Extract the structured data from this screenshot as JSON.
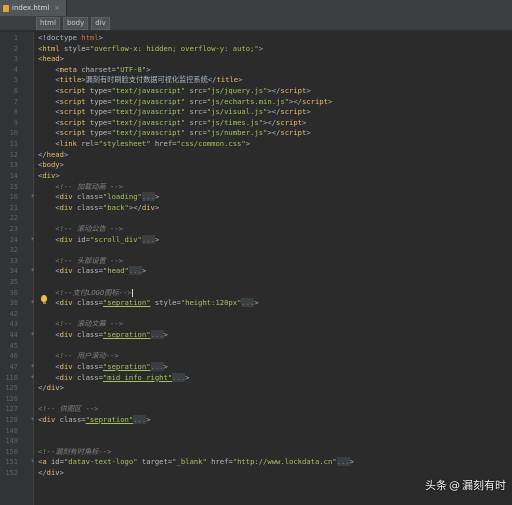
{
  "tab": {
    "filename": "index.html",
    "close_glyph": "×"
  },
  "breadcrumbs": [
    "html",
    "body",
    "div"
  ],
  "watermark": {
    "brand": "头条",
    "at": "@",
    "author": "漏刻有时"
  },
  "lines": [
    {
      "n": "1",
      "fold": "",
      "segs": [
        [
          "t",
          "<!doctype "
        ],
        [
          "k",
          "html"
        ],
        [
          "t",
          ">"
        ]
      ]
    },
    {
      "n": "2",
      "fold": "",
      "segs": [
        [
          "t",
          "<"
        ],
        [
          "g",
          "html"
        ],
        [
          "a",
          " style="
        ],
        [
          "v",
          "\"overflow-x: hidden; overflow-y: auto;\""
        ],
        [
          "t",
          ">"
        ]
      ]
    },
    {
      "n": "3",
      "fold": "",
      "segs": [
        [
          "t",
          "<"
        ],
        [
          "g",
          "head"
        ],
        [
          "t",
          ">"
        ]
      ]
    },
    {
      "n": "4",
      "fold": "",
      "segs": [
        [
          "t",
          "    <"
        ],
        [
          "g",
          "meta"
        ],
        [
          "a",
          " charset="
        ],
        [
          "v",
          "\"UTF-8\""
        ],
        [
          "t",
          ">"
        ]
      ]
    },
    {
      "n": "5",
      "fold": "",
      "segs": [
        [
          "t",
          "    <"
        ],
        [
          "g",
          "title"
        ],
        [
          "t",
          ">漏刻有时刷脸支付数据可视化监控系统</"
        ],
        [
          "g",
          "title"
        ],
        [
          "t",
          ">"
        ]
      ]
    },
    {
      "n": "6",
      "fold": "",
      "segs": [
        [
          "t",
          "    <"
        ],
        [
          "g",
          "script"
        ],
        [
          "a",
          " type="
        ],
        [
          "v",
          "\"text/javascript\""
        ],
        [
          "a",
          " src="
        ],
        [
          "v",
          "\"js/jquery.js\""
        ],
        [
          "t",
          "></"
        ],
        [
          "g",
          "script"
        ],
        [
          "t",
          ">"
        ]
      ]
    },
    {
      "n": "7",
      "fold": "",
      "segs": [
        [
          "t",
          "    <"
        ],
        [
          "g",
          "script"
        ],
        [
          "a",
          " type="
        ],
        [
          "v",
          "\"text/javascript\""
        ],
        [
          "a",
          " src="
        ],
        [
          "v",
          "\"js/echarts.min.js\""
        ],
        [
          "t",
          "></"
        ],
        [
          "g",
          "script"
        ],
        [
          "t",
          ">"
        ]
      ]
    },
    {
      "n": "8",
      "fold": "",
      "segs": [
        [
          "t",
          "    <"
        ],
        [
          "g",
          "script"
        ],
        [
          "a",
          " type="
        ],
        [
          "v",
          "\"text/javascript\""
        ],
        [
          "a",
          " src="
        ],
        [
          "v",
          "\"js/visual.js\""
        ],
        [
          "t",
          "></"
        ],
        [
          "g",
          "script"
        ],
        [
          "t",
          ">"
        ]
      ]
    },
    {
      "n": "9",
      "fold": "",
      "segs": [
        [
          "t",
          "    <"
        ],
        [
          "g",
          "script"
        ],
        [
          "a",
          " type="
        ],
        [
          "v",
          "\"text/javascript\""
        ],
        [
          "a",
          " src="
        ],
        [
          "v",
          "\"js/times.js\""
        ],
        [
          "t",
          "></"
        ],
        [
          "g",
          "script"
        ],
        [
          "t",
          ">"
        ]
      ]
    },
    {
      "n": "10",
      "fold": "",
      "segs": [
        [
          "t",
          "    <"
        ],
        [
          "g",
          "script"
        ],
        [
          "a",
          " type="
        ],
        [
          "v",
          "\"text/javascript\""
        ],
        [
          "a",
          " src="
        ],
        [
          "v",
          "\"js/number.js\""
        ],
        [
          "t",
          "></"
        ],
        [
          "g",
          "script"
        ],
        [
          "t",
          ">"
        ]
      ]
    },
    {
      "n": "11",
      "fold": "",
      "segs": [
        [
          "t",
          "    <"
        ],
        [
          "g",
          "link"
        ],
        [
          "a",
          " rel="
        ],
        [
          "v",
          "\"stylesheet\""
        ],
        [
          "a",
          " href="
        ],
        [
          "v",
          "\"css/common.css\""
        ],
        [
          "t",
          ">"
        ]
      ]
    },
    {
      "n": "12",
      "fold": "",
      "segs": [
        [
          "t",
          "</"
        ],
        [
          "g",
          "head"
        ],
        [
          "t",
          ">"
        ]
      ]
    },
    {
      "n": "13",
      "fold": "",
      "segs": [
        [
          "t",
          "<"
        ],
        [
          "g",
          "body"
        ],
        [
          "t",
          ">"
        ]
      ]
    },
    {
      "n": "14",
      "fold": "",
      "segs": [
        [
          "t",
          "<"
        ],
        [
          "g",
          "div"
        ],
        [
          "t",
          ">"
        ]
      ]
    },
    {
      "n": "15",
      "fold": "",
      "segs": [
        [
          "c",
          "    <!-- 加载动画 -->"
        ]
      ]
    },
    {
      "n": "16",
      "fold": "+",
      "segs": [
        [
          "t",
          "    <"
        ],
        [
          "g",
          "div"
        ],
        [
          "a",
          " class="
        ],
        [
          "v",
          "\"loading\""
        ],
        [
          "d",
          "..."
        ],
        [
          "t",
          ">"
        ]
      ]
    },
    {
      "n": "21",
      "fold": "",
      "segs": [
        [
          "t",
          "    <"
        ],
        [
          "g",
          "div"
        ],
        [
          "a",
          " class="
        ],
        [
          "v",
          "\"back\""
        ],
        [
          "t",
          "></"
        ],
        [
          "g",
          "div"
        ],
        [
          "t",
          ">"
        ]
      ]
    },
    {
      "n": "22",
      "fold": "",
      "segs": []
    },
    {
      "n": "23",
      "fold": "",
      "segs": [
        [
          "c",
          "    <!-- 滚动公告 -->"
        ]
      ]
    },
    {
      "n": "24",
      "fold": "+",
      "segs": [
        [
          "t",
          "    <"
        ],
        [
          "g",
          "div"
        ],
        [
          "a",
          " id="
        ],
        [
          "v",
          "\"scroll_div\""
        ],
        [
          "d",
          "..."
        ],
        [
          "t",
          ">"
        ]
      ]
    },
    {
      "n": "32",
      "fold": "",
      "segs": []
    },
    {
      "n": "33",
      "fold": "",
      "segs": [
        [
          "c",
          "    <!-- 头部设置 -->"
        ]
      ]
    },
    {
      "n": "34",
      "fold": "+",
      "segs": [
        [
          "t",
          "    <"
        ],
        [
          "g",
          "div"
        ],
        [
          "a",
          " class="
        ],
        [
          "v",
          "\"head\""
        ],
        [
          "d",
          "..."
        ],
        [
          "t",
          ">"
        ]
      ]
    },
    {
      "n": "35",
      "fold": "",
      "segs": []
    },
    {
      "n": "36",
      "fold": "",
      "segs": [
        [
          "c",
          "    <!--支付LOGO图标-->"
        ],
        [
          "x",
          ""
        ]
      ]
    },
    {
      "n": "38",
      "fold": "+",
      "segs": [
        [
          "t",
          "    <"
        ],
        [
          "g",
          "div"
        ],
        [
          "a",
          " class="
        ],
        [
          "u",
          "\"sepration\""
        ],
        [
          "a",
          " style="
        ],
        [
          "v",
          "\"height:120px\""
        ],
        [
          "d",
          "..."
        ],
        [
          "t",
          ">"
        ]
      ]
    },
    {
      "n": "42",
      "fold": "",
      "segs": []
    },
    {
      "n": "43",
      "fold": "",
      "segs": [
        [
          "c",
          "    <!-- 滚动文幕 -->"
        ]
      ]
    },
    {
      "n": "44",
      "fold": "+",
      "segs": [
        [
          "t",
          "    <"
        ],
        [
          "g",
          "div"
        ],
        [
          "a",
          " class="
        ],
        [
          "u",
          "\"sepration\""
        ],
        [
          "d",
          "..."
        ],
        [
          "t",
          ">"
        ]
      ]
    },
    {
      "n": "45",
      "fold": "",
      "segs": []
    },
    {
      "n": "46",
      "fold": "",
      "segs": [
        [
          "c",
          "    <!-- 用户滚动-->"
        ]
      ]
    },
    {
      "n": "47",
      "fold": "+",
      "segs": [
        [
          "t",
          "    <"
        ],
        [
          "g",
          "div"
        ],
        [
          "a",
          " class="
        ],
        [
          "u",
          "\"sepration\""
        ],
        [
          "d",
          "..."
        ],
        [
          "t",
          ">"
        ]
      ]
    },
    {
      "n": "118",
      "fold": "+",
      "segs": [
        [
          "t",
          "    <"
        ],
        [
          "g",
          "div"
        ],
        [
          "a",
          " class="
        ],
        [
          "u",
          "\"mid_info_right\""
        ],
        [
          "d",
          "..."
        ],
        [
          "t",
          ">"
        ]
      ]
    },
    {
      "n": "125",
      "fold": "",
      "segs": [
        [
          "t",
          "</"
        ],
        [
          "g",
          "div"
        ],
        [
          "t",
          ">"
        ]
      ]
    },
    {
      "n": "126",
      "fold": "",
      "segs": []
    },
    {
      "n": "127",
      "fold": "",
      "segs": [
        [
          "c",
          "<!-- 供图区 -->"
        ]
      ]
    },
    {
      "n": "128",
      "fold": "+",
      "segs": [
        [
          "t",
          "<"
        ],
        [
          "g",
          "div"
        ],
        [
          "a",
          " class="
        ],
        [
          "u",
          "\"sepration\""
        ],
        [
          "d",
          "..."
        ],
        [
          "t",
          ">"
        ]
      ]
    },
    {
      "n": "148",
      "fold": "",
      "segs": []
    },
    {
      "n": "149",
      "fold": "",
      "segs": []
    },
    {
      "n": "150",
      "fold": "",
      "segs": [
        [
          "c",
          "<!--漏刻有时角标-->"
        ]
      ]
    },
    {
      "n": "151",
      "fold": "+",
      "segs": [
        [
          "t",
          "<"
        ],
        [
          "g",
          "a"
        ],
        [
          "a",
          " id="
        ],
        [
          "v",
          "\"datav-text-logo\""
        ],
        [
          "a",
          " target="
        ],
        [
          "v",
          "\"_blank\""
        ],
        [
          "a",
          " href="
        ],
        [
          "v",
          "\"http://www.lockdata.cn\""
        ],
        [
          "d",
          "..."
        ],
        [
          "t",
          ">"
        ]
      ]
    },
    {
      "n": "152",
      "fold": "",
      "segs": [
        [
          "t",
          "</"
        ],
        [
          "g",
          "div"
        ],
        [
          "t",
          ">"
        ]
      ]
    }
  ]
}
